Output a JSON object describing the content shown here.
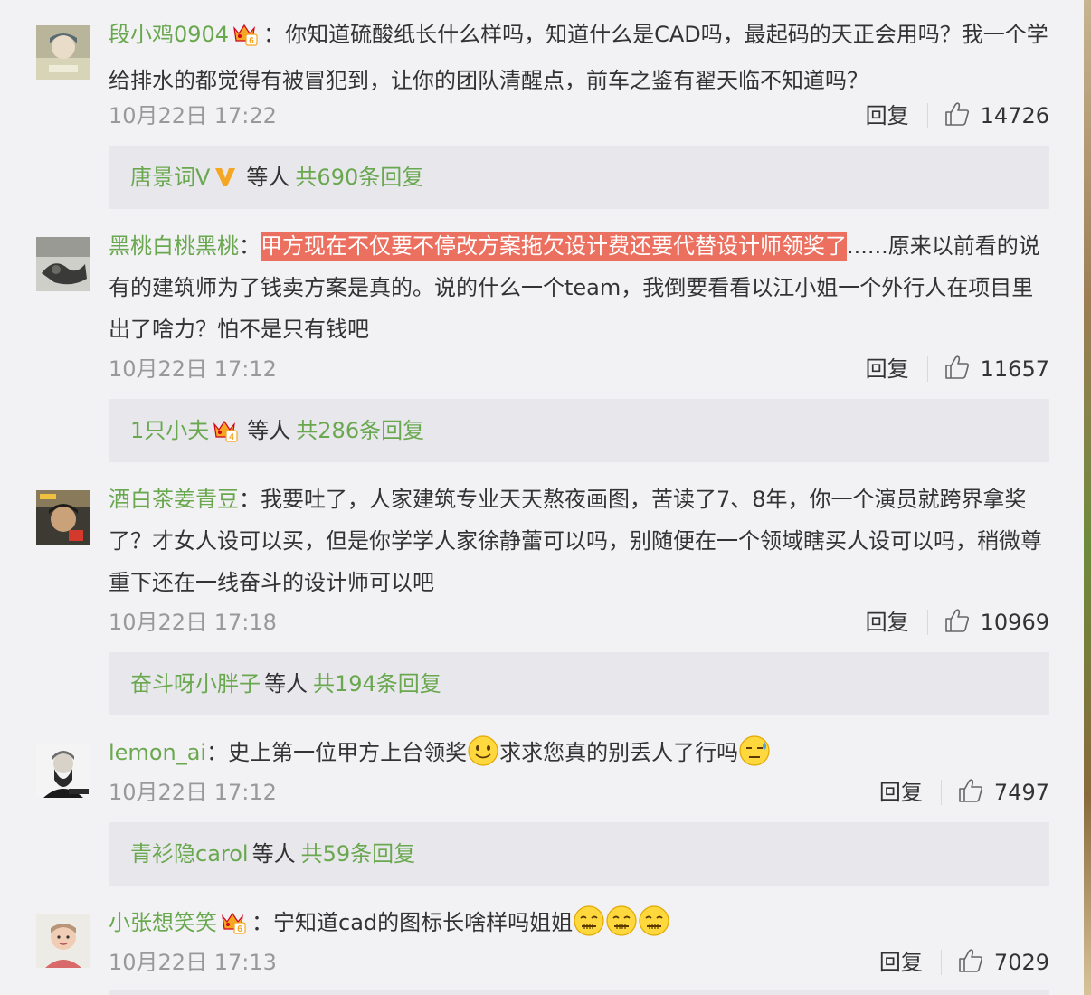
{
  "reply_label": "回复",
  "comments": [
    {
      "username": "段小鸡0904",
      "colon": "：",
      "badge_level": "6",
      "text": "你知道硫酸纸长什么样吗，知道什么是CAD吗，最起码的天正会用吗？我一个学给排水的都觉得有被冒犯到，让你的团队清醒点，前车之鉴有翟天临不知道吗？",
      "time": "10月22日 17:22",
      "likes": "14726",
      "reply_user": "唐景词V",
      "reply_etc": "等人",
      "reply_total": "共690条回复"
    },
    {
      "username": "黑桃白桃黑桃",
      "colon": "：",
      "text_highlight": "甲方现在不仅要不停改方案拖欠设计费还要代替设计师领奖了",
      "text": "......原来以前看的说有的建筑师为了钱卖方案是真的。说的什么一个team，我倒要看看以江小姐一个外行人在项目里出了啥力？怕不是只有钱吧",
      "time": "10月22日 17:12",
      "likes": "11657",
      "reply_user": "1只小夫",
      "reply_badge_level": "4",
      "reply_etc": "等人",
      "reply_total": "共286条回复"
    },
    {
      "username": "酒白茶姜青豆",
      "colon": "：",
      "text": "我要吐了，人家建筑专业天天熬夜画图，苦读了7、8年，你一个演员就跨界拿奖了？才女人设可以买，但是你学学人家徐静蕾可以吗，别随便在一个领域瞎买人设可以吗，稍微尊重下还在一线奋斗的设计师可以吧",
      "time": "10月22日 17:18",
      "likes": "10969",
      "reply_user": "奋斗呀小胖子",
      "reply_etc": "等人",
      "reply_total": "共194条回复"
    },
    {
      "username": "lemon_ai",
      "colon": "：",
      "text_part1": "史上第一位甲方上台领奖",
      "text_part2": "求求您真的别丢人了行吗",
      "time": "10月22日 17:12",
      "likes": "7497",
      "reply_user": "青衫隐carol",
      "reply_etc": "等人",
      "reply_total": "共59条回复"
    },
    {
      "username": "小张想笑笑",
      "colon": "：",
      "badge_level": "6",
      "text": "宁知道cad的图标长啥样吗姐姐",
      "time": "10月22日 17:13",
      "likes": "7029"
    }
  ],
  "colors": {
    "username": "#6aa84f",
    "highlight": "#ec7060",
    "reply_box": "#e7e7ec",
    "background": "#f2f2f5"
  }
}
